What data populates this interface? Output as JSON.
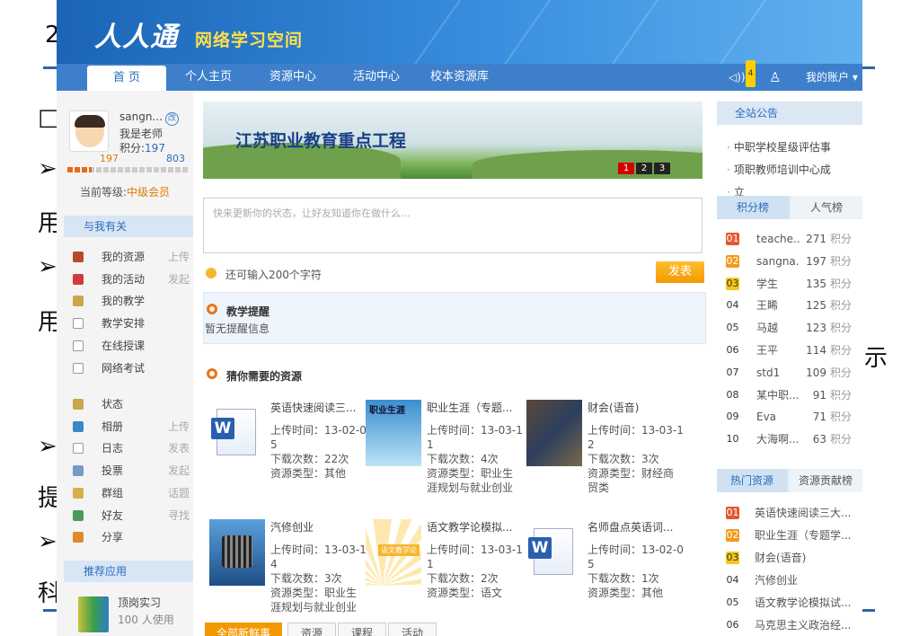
{
  "slide": {
    "colors": {
      "rule": "#2e64a8"
    },
    "fragments": [
      "2",
      "□",
      "➢",
      "用",
      "➢",
      "用",
      "示",
      "➢",
      "提",
      "➢",
      "科"
    ]
  },
  "header": {
    "logo_script": "人人通",
    "logo_text": "网络学习空间",
    "colors": {
      "banner": "#3a8fe0",
      "logo_text": "#ffe04a"
    }
  },
  "nav": {
    "tabs": [
      {
        "label": "首  页",
        "active": true
      },
      {
        "label": "个人主页"
      },
      {
        "label": "资源中心"
      },
      {
        "label": "活动中心"
      },
      {
        "label": "校本资源库"
      }
    ],
    "sound_icon": "speaker-icon",
    "notice_count": "4",
    "user_icon": "person-icon",
    "account_label": "我的账户"
  },
  "profile": {
    "name": "sangn...",
    "role": "我是老师",
    "points_label": "积分:",
    "points": "197",
    "level_current": "197",
    "level_next": "803",
    "level_progress": 0.2,
    "current_level_label": "当前等级:",
    "current_level": "中级会员"
  },
  "related": {
    "title": "与我有关",
    "items": [
      {
        "label": "我的资源",
        "action": "上传",
        "icon": "book-icon",
        "color": "#b84a2a"
      },
      {
        "label": "我的活动",
        "action": "发起",
        "icon": "flag-icon",
        "color": "#d23a3a"
      },
      {
        "label": "我的教学",
        "action": "",
        "icon": "notebook-icon",
        "color": "#c9a74a"
      },
      {
        "label": "教学安排",
        "action": "",
        "icon": "document-icon",
        "color": "#ffffff"
      },
      {
        "label": "在线授课",
        "action": "",
        "icon": "document-icon",
        "color": "#ffffff"
      },
      {
        "label": "网络考试",
        "action": "",
        "icon": "document-icon",
        "color": "#ffffff"
      }
    ],
    "social": [
      {
        "label": "状态",
        "action": "",
        "icon": "pencil-icon",
        "color": "#c9a74a"
      },
      {
        "label": "相册",
        "action": "上传",
        "icon": "photo-icon",
        "color": "#3a86c6"
      },
      {
        "label": "日志",
        "action": "发表",
        "icon": "document-icon",
        "color": "#ffffff"
      },
      {
        "label": "投票",
        "action": "发起",
        "icon": "vote-icon",
        "color": "#7a9ac6"
      },
      {
        "label": "群组",
        "action": "话题",
        "icon": "group-icon",
        "color": "#d8b04a"
      },
      {
        "label": "好友",
        "action": "寻找",
        "icon": "friends-icon",
        "color": "#4a9a5a"
      },
      {
        "label": "分享",
        "action": "",
        "icon": "share-icon",
        "color": "#e0892a"
      }
    ]
  },
  "apps": {
    "title": "推荐应用",
    "name": "顶岗实习",
    "users": "100 人使用"
  },
  "carousel": {
    "title": "江苏职业教育重点工程",
    "pages": [
      "1",
      "2",
      "3"
    ]
  },
  "status": {
    "placeholder": "快来更新你的状态，让好友知道你在做什么...",
    "remaining": "还可输入200个字符",
    "post_label": "发表"
  },
  "reminder": {
    "title": "教学提醒",
    "text": "暂无提醒信息"
  },
  "resources": {
    "title": "猜你需要的资源",
    "items": [
      {
        "title": "英语快速阅读三...",
        "thumb": "word-doc",
        "details": "上传时间：13-02-0\n5\n下载次数：22次\n资源类型：其他"
      },
      {
        "title": "职业生涯（专题...",
        "thumb": "book-cover",
        "thumb_text": "职业生涯",
        "details": "上传时间：13-03-1\n1\n下载次数：4次\n资源类型：职业生\n涯规划与就业创业"
      },
      {
        "title": "财会(语音)",
        "thumb": "photo",
        "details": "上传时间：13-03-1\n2\n下载次数：3次\n资源类型：财经商\n贸类"
      },
      {
        "title": "汽修创业",
        "thumb": "screen",
        "details": "上传时间：13-03-1\n4\n下载次数：3次\n资源类型：职业生\n涯规划与就业创业"
      },
      {
        "title": "语文教学论模拟...",
        "thumb": "fan",
        "thumb_text": "语文教学论",
        "details": "上传时间：13-03-1\n1\n下载次数：2次\n资源类型：语文"
      },
      {
        "title": "名师盘点英语词...",
        "thumb": "word-doc",
        "details": "上传时间：13-02-0\n5\n下载次数：1次\n资源类型：其他"
      }
    ]
  },
  "feed_tabs": [
    "全部新鲜事",
    "资源",
    "课程",
    "活动"
  ],
  "announcements": {
    "title": "全站公告",
    "items": [
      "中职学校星级评估事",
      "项职教师培训中心成",
      "立"
    ]
  },
  "ranking": {
    "tabs": [
      "积分榜",
      "人气榜"
    ],
    "unit": "积分",
    "rows": [
      {
        "rank": "01",
        "name": "teache...",
        "score": "271"
      },
      {
        "rank": "02",
        "name": "sangna...",
        "score": "197"
      },
      {
        "rank": "03",
        "name": "学生",
        "score": "135"
      },
      {
        "rank": "04",
        "name": "王睎",
        "score": "125"
      },
      {
        "rank": "05",
        "name": "马越",
        "score": "123"
      },
      {
        "rank": "06",
        "name": "王平",
        "score": "114"
      },
      {
        "rank": "07",
        "name": "std1",
        "score": "109"
      },
      {
        "rank": "08",
        "name": "某中职...",
        "score": "91"
      },
      {
        "rank": "09",
        "name": "Eva",
        "score": "71"
      },
      {
        "rank": "10",
        "name": "大海啊...",
        "score": "63"
      }
    ]
  },
  "hot": {
    "tabs": [
      "热门资源",
      "资源贡献榜"
    ],
    "rows": [
      {
        "rank": "01",
        "title": "英语快速阅读三大..."
      },
      {
        "rank": "02",
        "title": "职业生涯（专题学..."
      },
      {
        "rank": "03",
        "title": "财会(语音)"
      },
      {
        "rank": "04",
        "title": "汽修创业"
      },
      {
        "rank": "05",
        "title": "语文教学论模拟试..."
      },
      {
        "rank": "06",
        "title": "马克思主义政治经..."
      }
    ]
  }
}
